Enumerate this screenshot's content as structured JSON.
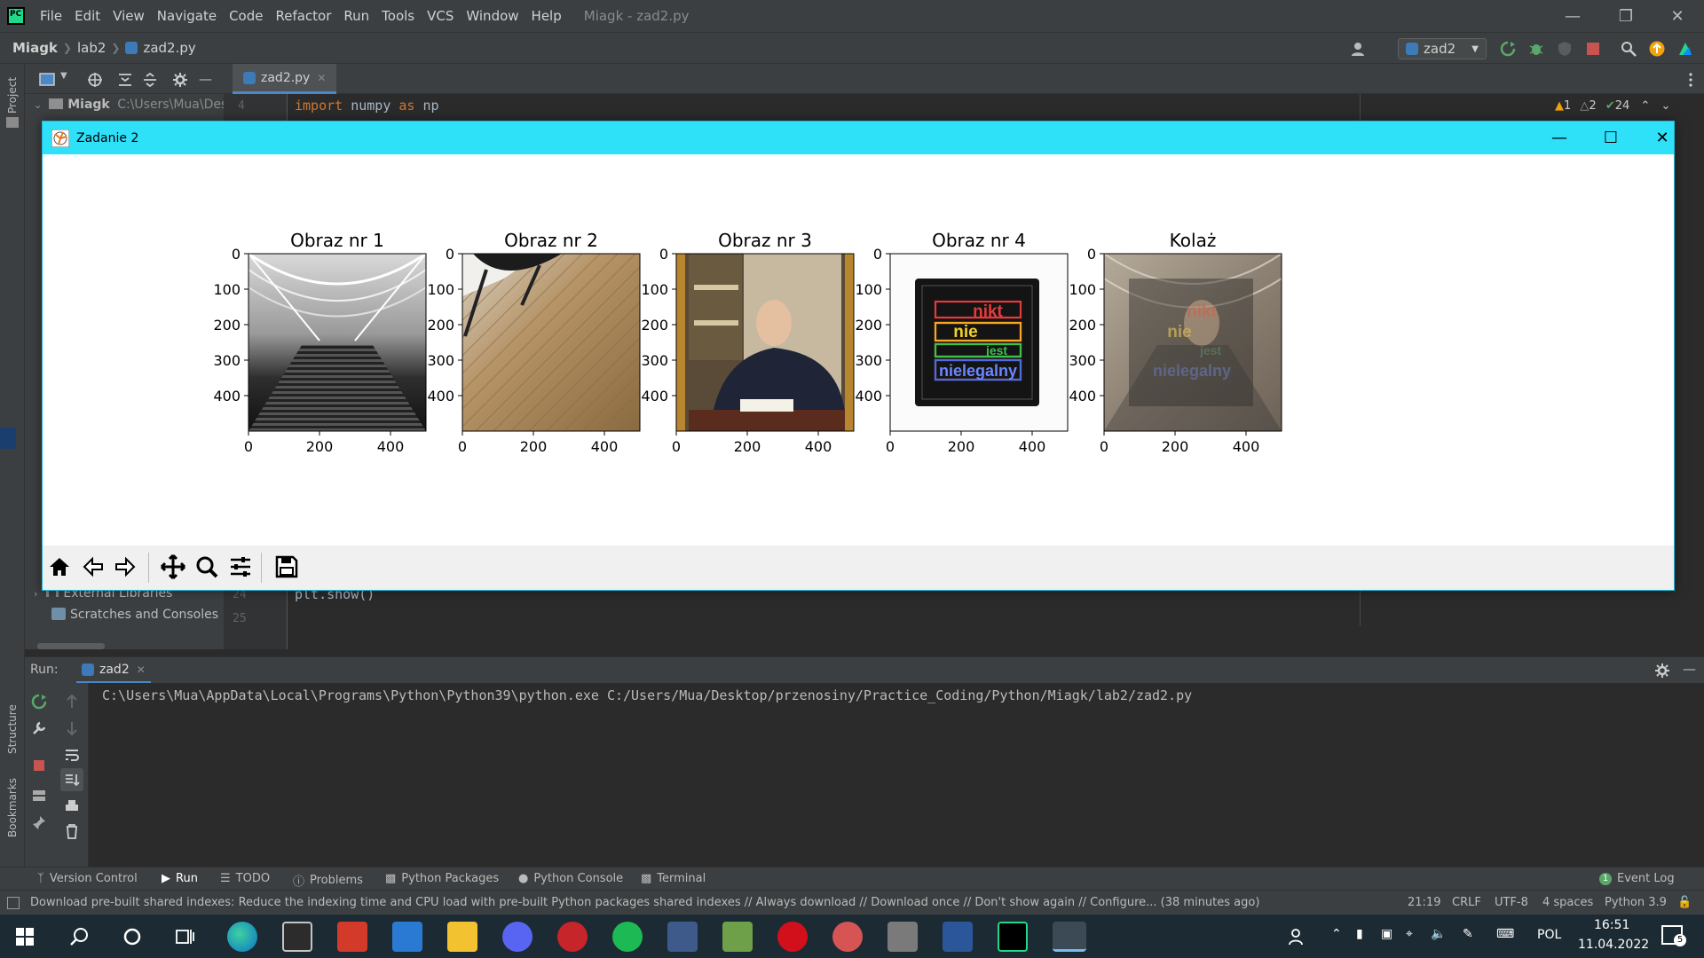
{
  "menubar": {
    "items": [
      "File",
      "Edit",
      "View",
      "Navigate",
      "Code",
      "Refactor",
      "Run",
      "Tools",
      "VCS",
      "Window",
      "Help"
    ],
    "window_title": "Miagk - zad2.py"
  },
  "navbar": {
    "breadcrumb": [
      "Miagk",
      "lab2",
      "zad2.py"
    ],
    "run_config": "zad2"
  },
  "left_strip": {
    "project_tab": "Project",
    "structure_tab": "Structure",
    "bookmarks_tab": "Bookmarks"
  },
  "project": {
    "root_name": "Miagk",
    "root_path": "C:\\Users\\Mua\\Des",
    "external_libraries": "External Libraries",
    "scratches": "Scratches and Consoles"
  },
  "editor": {
    "tab_label": "zad2.py",
    "line4_num": "4",
    "line4_kw1": "import",
    "line4_mod": " numpy ",
    "line4_kw2": "as",
    "line4_alias": " np",
    "line24_num": "24",
    "line24_code": "plt.show()",
    "line25_num": "25",
    "inspection": {
      "warnings": "1",
      "weak_warnings": "2",
      "ok": "24"
    }
  },
  "mpl_window": {
    "title": "Zadanie 2",
    "subplots": [
      {
        "title": "Obraz nr 1"
      },
      {
        "title": "Obraz nr 2"
      },
      {
        "title": "Obraz nr 3"
      },
      {
        "title": "Obraz nr 4"
      },
      {
        "title": "Kolaż"
      }
    ],
    "y_ticks": [
      "0",
      "100",
      "200",
      "300",
      "400"
    ],
    "x_ticks": [
      "0",
      "200",
      "400"
    ],
    "sticker_lines": [
      "nikt",
      "nie",
      "jest",
      "nielegalny"
    ],
    "toolbar": [
      "home",
      "back",
      "forward",
      "pan",
      "zoom",
      "configure",
      "save"
    ]
  },
  "run_panel": {
    "label": "Run:",
    "tab": "zad2",
    "console_line": "C:\\Users\\Mua\\AppData\\Local\\Programs\\Python\\Python39\\python.exe C:/Users/Mua/Desktop/przenosiny/Practice_Coding/Python/Miagk/lab2/zad2.py"
  },
  "tool_tabs": [
    "Version Control",
    "Run",
    "TODO",
    "Problems",
    "Python Packages",
    "Python Console",
    "Terminal"
  ],
  "event_log": "Event Log",
  "event_log_count": "1",
  "statusbar": {
    "message": "Download pre-built shared indexes: Reduce the indexing time and CPU load with pre-built Python packages shared indexes // Always download // Download once // Don't show again // Configure... (38 minutes ago)",
    "position": "21:19",
    "line_sep": "CRLF",
    "encoding": "UTF-8",
    "indent": "4 spaces",
    "interpreter": "Python 3.9"
  },
  "taskbar": {
    "language": "POL",
    "time": "16:51",
    "date": "11.04.2022",
    "notifications": "5"
  },
  "colors": {
    "ide_bg": "#2b2b2b",
    "panel_bg": "#3c3f41",
    "mpl_titlebar": "#2ee0f8",
    "keyword": "#cc7832"
  }
}
